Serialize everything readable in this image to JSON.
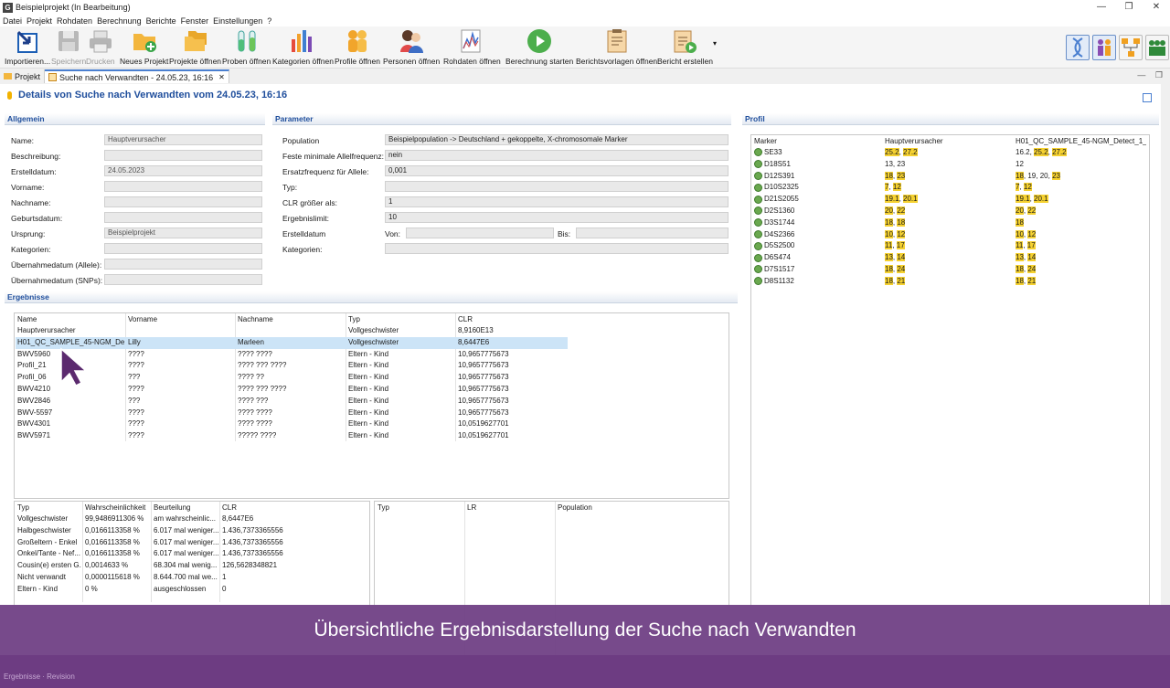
{
  "window": {
    "title": "Beispielprojekt (In Bearbeitung)",
    "app_letter": "G",
    "controls": [
      "—",
      "❐",
      "✕"
    ]
  },
  "menu": [
    "Datei",
    "Projekt",
    "Rohdaten",
    "Berechnung",
    "Berichte",
    "Fenster",
    "Einstellungen",
    "?"
  ],
  "toolbar": {
    "importieren": "Importieren...",
    "speichern": "Speichern",
    "drucken": "Drucken",
    "neues_projekt": "Neues Projekt",
    "projekte_oeffnen": "Projekte öffnen",
    "proben_oeffnen": "Proben öffnen",
    "kategorien_oeffnen": "Kategorien öffnen",
    "profile_oeffnen": "Profile öffnen",
    "personen_oeffnen": "Personen öffnen",
    "rohdaten_oeffnen": "Rohdaten öffnen",
    "berechnung_starten": "Berechnung starten",
    "berichtsvorlagen_oeffnen": "Berichtsvorlagen öffnen",
    "bericht_erstellen": "Bericht erstellen"
  },
  "tabs": {
    "projekt": "Projekt",
    "suche": "Suche nach Verwandten - 24.05.23, 16:16",
    "close": "✕",
    "controls": "— ❐"
  },
  "heading": "Details von Suche nach Verwandten vom 24.05.23, 16:16",
  "allgemein": {
    "title": "Allgemein",
    "fields": [
      {
        "label": "Name:",
        "value": "Hauptverursacher"
      },
      {
        "label": "Beschreibung:",
        "value": ""
      },
      {
        "label": "Erstelldatum:",
        "value": "24.05.2023"
      },
      {
        "label": "Vorname:",
        "value": ""
      },
      {
        "label": "Nachname:",
        "value": ""
      },
      {
        "label": "Geburtsdatum:",
        "value": ""
      },
      {
        "label": "Ursprung:",
        "value": "Beispielprojekt"
      },
      {
        "label": "Kategorien:",
        "value": ""
      },
      {
        "label": "Übernahmedatum (Allele):",
        "value": ""
      },
      {
        "label": "Übernahmedatum (SNPs):",
        "value": ""
      }
    ]
  },
  "parameter": {
    "title": "Parameter",
    "population_label": "Population",
    "population_value": "Beispielpopulation -> Deutschland + gekoppelte, X-chromosomale Marker",
    "feste_label": "Feste minimale Allelfrequenz:",
    "feste_value": "nein",
    "ersatz_label": "Ersatzfrequenz für Allele:",
    "ersatz_value": "0,001",
    "typ_label": "Typ:",
    "typ_value": "",
    "clr_label": "CLR größer als:",
    "clr_value": "1",
    "limit_label": "Ergebnislimit:",
    "limit_value": "10",
    "erstelldatum_label": "Erstelldatum",
    "von_label": "Von:",
    "bis_label": "Bis:",
    "kategorien_label": "Kategorien:"
  },
  "ergebnisse": {
    "title": "Ergebnisse",
    "headers": [
      "Name",
      "Vorname",
      "Nachname",
      "Typ",
      "CLR"
    ],
    "rows": [
      [
        "Hauptverursacher",
        "",
        "",
        "Vollgeschwister",
        "8,9160E13"
      ],
      [
        "H01_QC_SAMPLE_45-NGM_Det...",
        "Lilly",
        "Marleen",
        "Vollgeschwister",
        "8,6447E6"
      ],
      [
        "BWV5960",
        "????",
        " ???? ????",
        "Eltern - Kind",
        "10,9657775673"
      ],
      [
        "Profil_21",
        "????",
        " ???? ??? ????",
        "Eltern - Kind",
        "10,9657775673"
      ],
      [
        "Profil_06",
        "???",
        "???? ??",
        "Eltern - Kind",
        "10,9657775673"
      ],
      [
        "BWV4210",
        "????",
        " ???? ??? ????",
        "Eltern - Kind",
        "10,9657775673"
      ],
      [
        "BWV2846",
        "???",
        "???? ???",
        "Eltern - Kind",
        "10,9657775673"
      ],
      [
        "BWV-5597",
        "????",
        " ???? ????",
        "Eltern - Kind",
        "10,9657775673"
      ],
      [
        "BWV4301",
        "????",
        " ???? ????",
        "Eltern - Kind",
        "10,0519627701"
      ],
      [
        "BWV5971",
        "????",
        " ????? ????",
        "Eltern - Kind",
        "10,0519627701"
      ]
    ]
  },
  "details": {
    "headers": [
      "Typ",
      "Wahrscheinlichkeit",
      "Beurteilung",
      "CLR"
    ],
    "rows": [
      [
        "Vollgeschwister",
        "99,9486911306 %",
        "am wahrscheinlic...",
        "8,6447E6"
      ],
      [
        "Halbgeschwister",
        "0,0166113358 %",
        "6.017 mal weniger...",
        "1.436,7373365556"
      ],
      [
        "Großeltern - Enkel",
        "0,0166113358 %",
        "6.017 mal weniger...",
        "1.436,7373365556"
      ],
      [
        "Onkel/Tante - Nef...",
        "0,0166113358 %",
        "6.017 mal weniger...",
        "1.436,7373365556"
      ],
      [
        "Cousin(e) ersten G...",
        "0,0014633 %",
        "68.304 mal wenig...",
        "126,5628348821"
      ],
      [
        "Nicht verwandt",
        "0,0000115618 %",
        "8.644.700 mal we...",
        "1"
      ],
      [
        "Eltern - Kind",
        "0 %",
        "ausgeschlossen",
        "0"
      ]
    ]
  },
  "lr": {
    "headers": [
      "Typ",
      "LR",
      "Population"
    ]
  },
  "profil": {
    "title": "Profil",
    "headers": [
      "Marker",
      "Hauptverursacher",
      "H01_QC_SAMPLE_45-NGM_Detect_1_..."
    ],
    "rows": [
      {
        "marker": "SE33",
        "a": [
          {
            "v": "25.2",
            "h": true
          },
          {
            "v": "27.2",
            "h": true
          }
        ],
        "b": [
          {
            "v": "16.2",
            "h": false
          },
          {
            "v": "25.2",
            "h": true
          },
          {
            "v": "27.2",
            "h": true
          }
        ]
      },
      {
        "marker": "D18S51",
        "a": [
          {
            "v": "13",
            "h": false
          },
          {
            "v": "23",
            "h": false
          }
        ],
        "b": [
          {
            "v": "12",
            "h": false
          }
        ]
      },
      {
        "marker": "D12S391",
        "a": [
          {
            "v": "18",
            "h": true
          },
          {
            "v": "23",
            "h": true
          }
        ],
        "b": [
          {
            "v": "18",
            "h": true
          },
          {
            "v": "19",
            "h": false
          },
          {
            "v": "20",
            "h": false
          },
          {
            "v": "23",
            "h": true
          }
        ]
      },
      {
        "marker": "D10S2325",
        "a": [
          {
            "v": "7",
            "h": true
          },
          {
            "v": "12",
            "h": true
          }
        ],
        "b": [
          {
            "v": "7",
            "h": true
          },
          {
            "v": "12",
            "h": true
          }
        ]
      },
      {
        "marker": "D21S2055",
        "a": [
          {
            "v": "19.1",
            "h": true
          },
          {
            "v": "20.1",
            "h": true
          }
        ],
        "b": [
          {
            "v": "19.1",
            "h": true
          },
          {
            "v": "20.1",
            "h": true
          }
        ]
      },
      {
        "marker": "D2S1360",
        "a": [
          {
            "v": "20",
            "h": true
          },
          {
            "v": "22",
            "h": true
          }
        ],
        "b": [
          {
            "v": "20",
            "h": true
          },
          {
            "v": "22",
            "h": true
          }
        ]
      },
      {
        "marker": "D3S1744",
        "a": [
          {
            "v": "18",
            "h": true
          },
          {
            "v": "18",
            "h": true
          }
        ],
        "b": [
          {
            "v": "18",
            "h": true
          }
        ]
      },
      {
        "marker": "D4S2366",
        "a": [
          {
            "v": "10",
            "h": true
          },
          {
            "v": "12",
            "h": true
          }
        ],
        "b": [
          {
            "v": "10",
            "h": true
          },
          {
            "v": "12",
            "h": true
          }
        ]
      },
      {
        "marker": "D5S2500",
        "a": [
          {
            "v": "11",
            "h": true
          },
          {
            "v": "17",
            "h": true
          }
        ],
        "b": [
          {
            "v": "11",
            "h": true
          },
          {
            "v": "17",
            "h": true
          }
        ]
      },
      {
        "marker": "D6S474",
        "a": [
          {
            "v": "13",
            "h": true
          },
          {
            "v": "14",
            "h": true
          }
        ],
        "b": [
          {
            "v": "13",
            "h": true
          },
          {
            "v": "14",
            "h": true
          }
        ]
      },
      {
        "marker": "D7S1517",
        "a": [
          {
            "v": "18",
            "h": true
          },
          {
            "v": "24",
            "h": true
          }
        ],
        "b": [
          {
            "v": "18",
            "h": true
          },
          {
            "v": "24",
            "h": true
          }
        ]
      },
      {
        "marker": "D8S1132",
        "a": [
          {
            "v": "18",
            "h": true
          },
          {
            "v": "21",
            "h": true
          }
        ],
        "b": [
          {
            "v": "18",
            "h": true
          },
          {
            "v": "21",
            "h": true
          }
        ]
      }
    ]
  },
  "banner": "Übersichtliche Ergebnisdarstellung der Suche nach Verwandten",
  "status": "Ergebnisse · Revision"
}
